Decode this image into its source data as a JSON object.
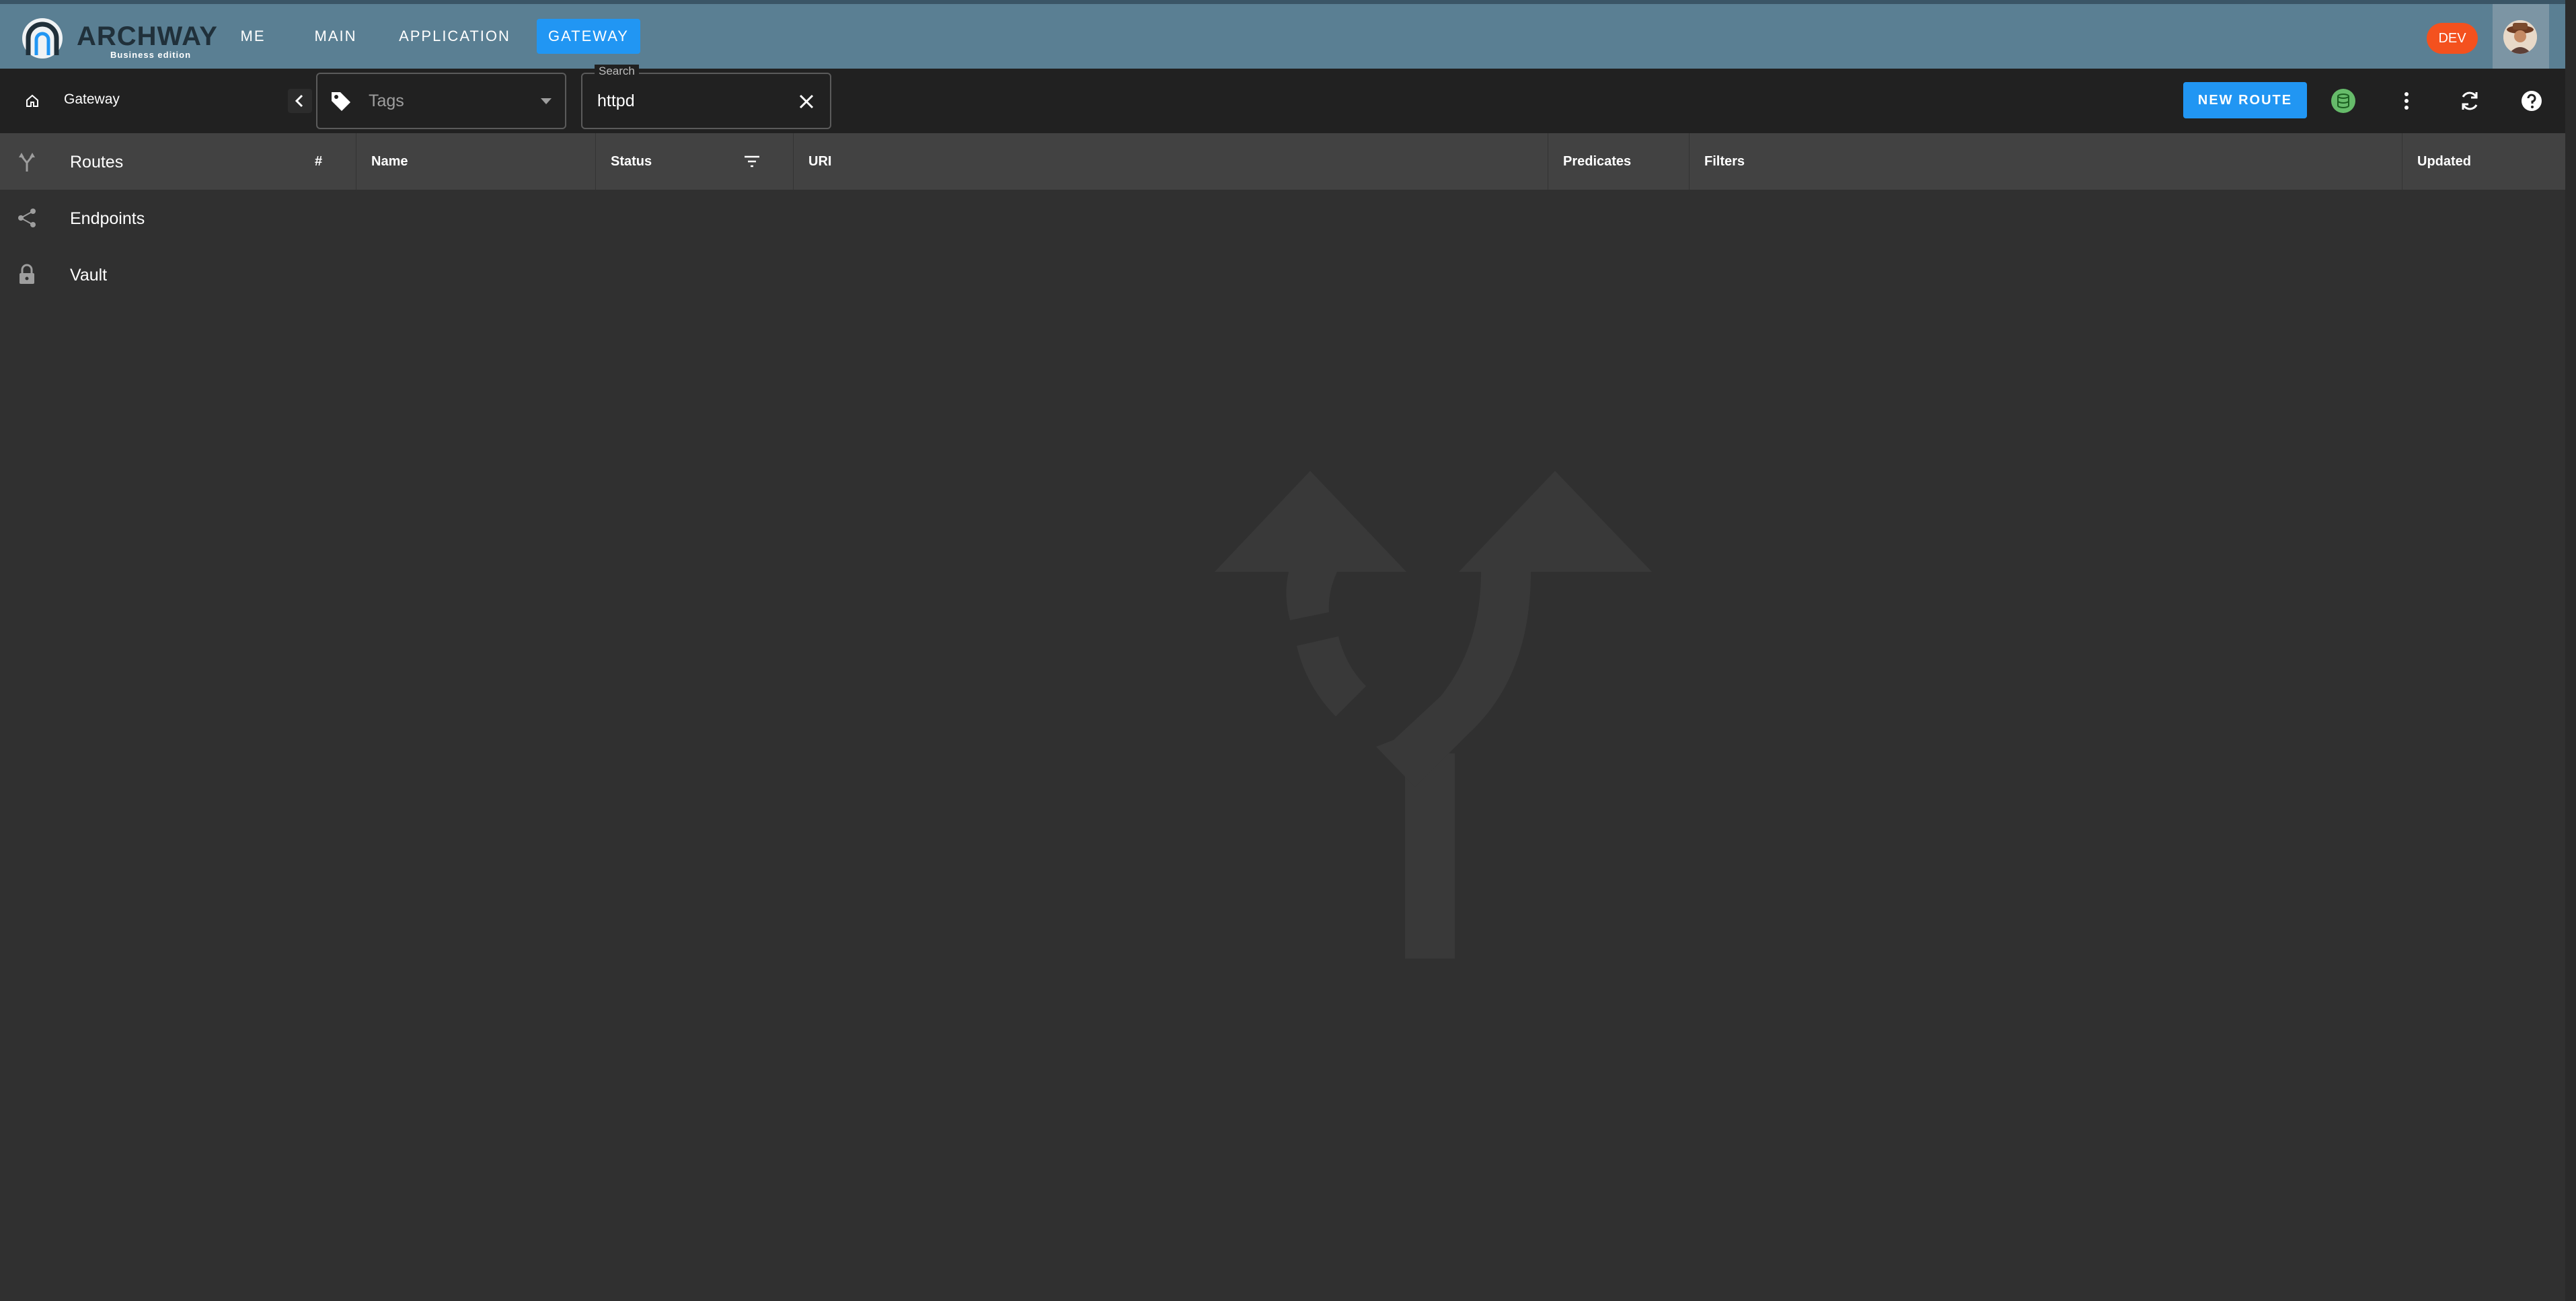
{
  "app": {
    "logo_text": "ARCHWAY",
    "logo_subtitle": "Business edition",
    "nav_tabs": [
      {
        "label": "ME",
        "active": false
      },
      {
        "label": "MAIN",
        "active": false
      },
      {
        "label": "APPLICATION",
        "active": false
      },
      {
        "label": "GATEWAY",
        "active": true
      }
    ],
    "env_badge": "DEV",
    "accent_color": "#2196f3",
    "topbar_color": "#5a7f93"
  },
  "subbar": {
    "breadcrumb": "Gateway",
    "tags_placeholder": "Tags",
    "search_label": "Search",
    "search_value": "httpd",
    "new_route_label": "NEW ROUTE",
    "status_color": "#66bb6a"
  },
  "sidebar": {
    "items": [
      {
        "label": "Routes",
        "icon": "fork-icon",
        "active": true
      },
      {
        "label": "Endpoints",
        "icon": "share-icon",
        "active": false
      },
      {
        "label": "Vault",
        "icon": "lock-icon",
        "active": false
      }
    ]
  },
  "table": {
    "columns": [
      "#",
      "Name",
      "Status",
      "URI",
      "Predicates",
      "Filters",
      "Updated"
    ],
    "rows": []
  }
}
